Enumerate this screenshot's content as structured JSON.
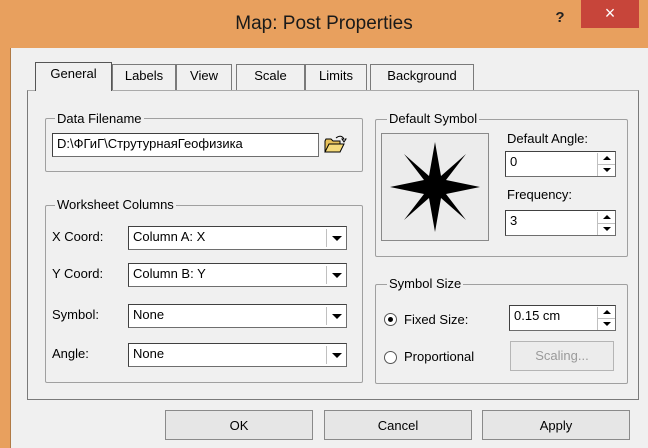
{
  "window": {
    "title": "Map: Post Properties",
    "help_label": "?",
    "close_label": "×"
  },
  "tabs": [
    {
      "label": "General",
      "selected": true
    },
    {
      "label": "Labels"
    },
    {
      "label": "View"
    },
    {
      "label": "Scale"
    },
    {
      "label": "Limits"
    },
    {
      "label": "Background"
    }
  ],
  "data_filename": {
    "group_label": "Data Filename",
    "value": "D:\\ФГиГ\\СтрутурнаяГеофизика",
    "open_icon": "open-folder-icon"
  },
  "worksheet_columns": {
    "group_label": "Worksheet Columns",
    "rows": [
      {
        "label": "X Coord:",
        "value": "Column A:  X"
      },
      {
        "label": "Y Coord:",
        "value": "Column B:  Y"
      },
      {
        "label": "Symbol:",
        "value": "None"
      },
      {
        "label": "Angle:",
        "value": "None"
      }
    ]
  },
  "default_symbol": {
    "group_label": "Default Symbol",
    "symbol_icon": "star-burst-symbol-icon",
    "angle_label": "Default Angle:",
    "angle_value": "0",
    "frequency_label": "Frequency:",
    "frequency_value": "3"
  },
  "symbol_size": {
    "group_label": "Symbol Size",
    "fixed_label": "Fixed Size:",
    "fixed_value": "0.15 cm",
    "fixed_checked": true,
    "proportional_label": "Proportional",
    "scaling_label": "Scaling..."
  },
  "buttons": {
    "ok": "OK",
    "cancel": "Cancel",
    "apply": "Apply"
  },
  "colors": {
    "titlebar": "#e8a05e",
    "close_button": "#c7453a"
  }
}
